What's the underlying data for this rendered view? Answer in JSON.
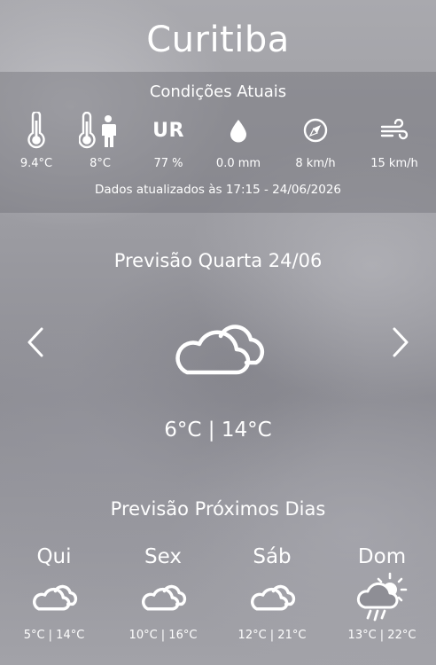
{
  "city": "Curitiba",
  "current": {
    "title": "Condições Atuais",
    "stats": [
      {
        "icon": "thermometer-icon",
        "value": "9.4°C"
      },
      {
        "icon": "feels-like-icon",
        "value": "8°C"
      },
      {
        "icon": "humidity-ur-icon",
        "label": "UR",
        "value": "77 %"
      },
      {
        "icon": "rain-drop-icon",
        "value": "0.0 mm"
      },
      {
        "icon": "wind-direction-icon",
        "value": "8 km/h"
      },
      {
        "icon": "wind-gust-icon",
        "value": "15 km/h"
      }
    ],
    "updated": "Dados atualizados às 17:15 - 24/06/2026"
  },
  "forecast": {
    "title": "Previsão Quarta 24/06",
    "icon": "cloudy-icon",
    "temp": "6°C | 14°C"
  },
  "next_days": {
    "title": "Previsão Próximos Dias",
    "days": [
      {
        "name": "Qui",
        "icon": "cloudy-icon",
        "temp": "5°C | 14°C"
      },
      {
        "name": "Sex",
        "icon": "cloudy-icon",
        "temp": "10°C | 16°C"
      },
      {
        "name": "Sáb",
        "icon": "cloudy-icon",
        "temp": "12°C | 21°C"
      },
      {
        "name": "Dom",
        "icon": "sun-rain-cloud-icon",
        "temp": "13°C | 22°C"
      }
    ]
  }
}
